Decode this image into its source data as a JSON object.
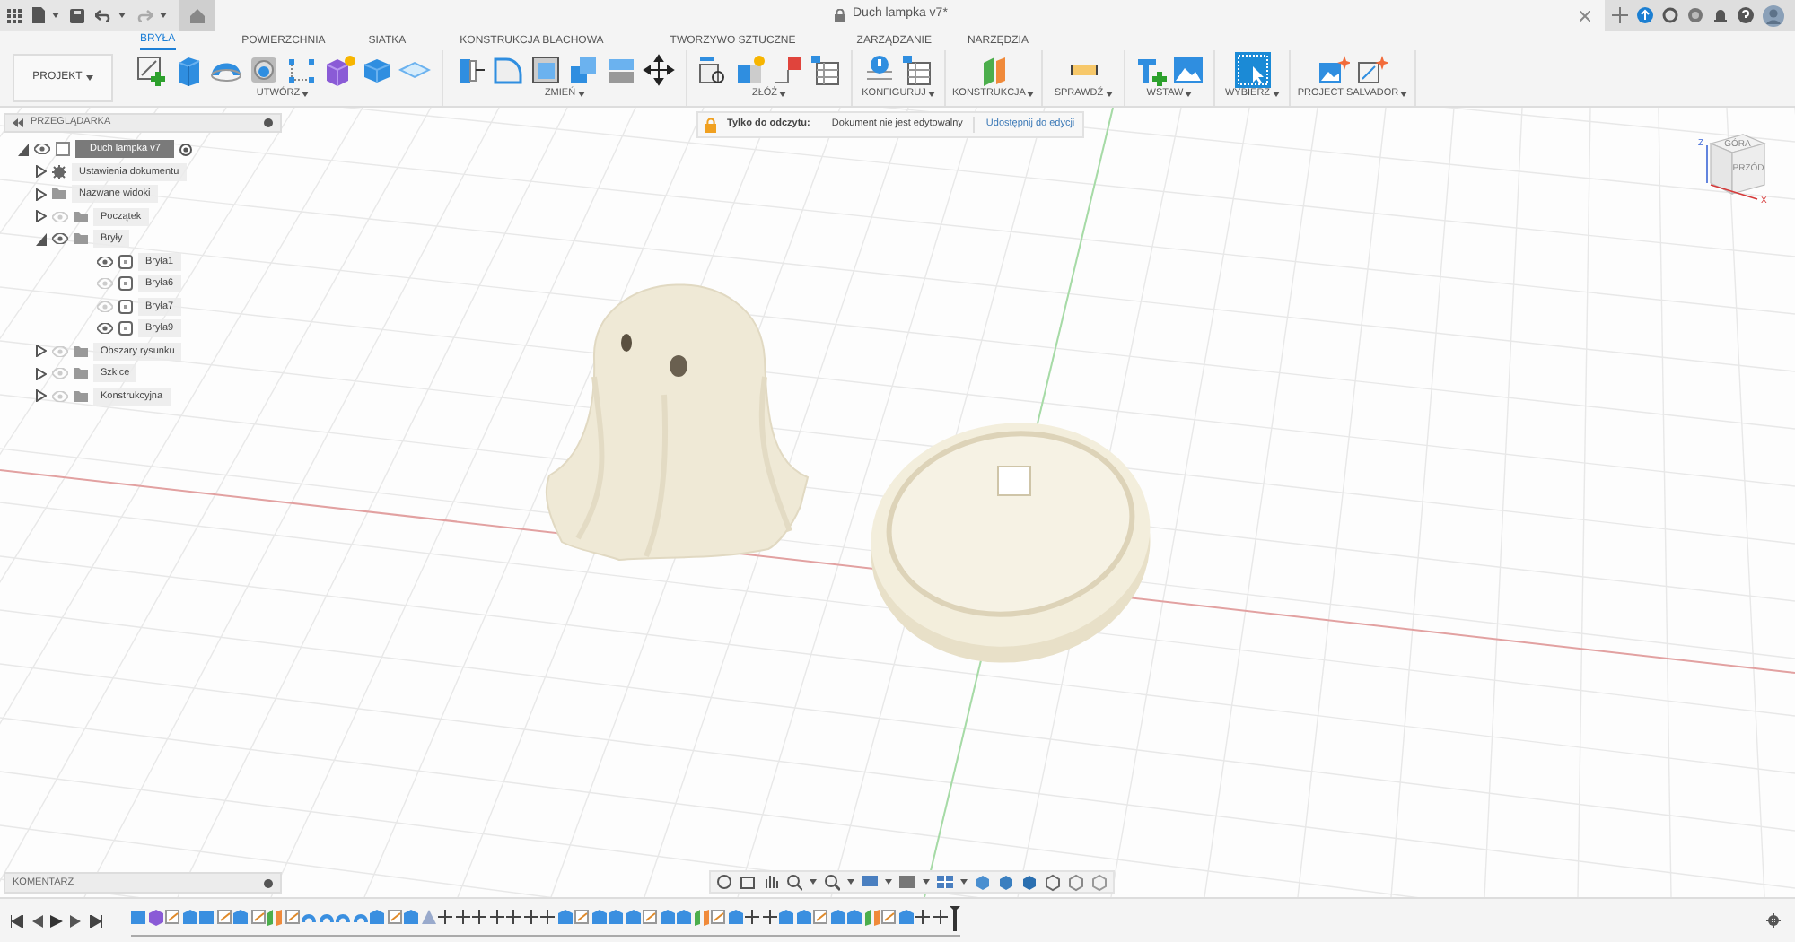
{
  "title_bar": {
    "document_title": "Duch lampka v7*"
  },
  "ribbon": {
    "workspace_button": "PROJEKT",
    "tabs": [
      {
        "label": "BRYŁA",
        "selected": true
      },
      {
        "label": "POWIERZCHNIA",
        "selected": false
      },
      {
        "label": "SIATKA",
        "selected": false
      },
      {
        "label": "KONSTRUKCJA BLACHOWA",
        "selected": false
      },
      {
        "label": "TWORZYWO SZTUCZNE",
        "selected": false
      },
      {
        "label": "ZARZĄDZANIE",
        "selected": false
      },
      {
        "label": "NARZĘDZIA",
        "selected": false
      }
    ],
    "groups": [
      {
        "label": "UTWÓRZ"
      },
      {
        "label": "ZMIEŃ"
      },
      {
        "label": "ZŁÓŻ"
      },
      {
        "label": "KONFIGURUJ"
      },
      {
        "label": "KONSTRUKCJA"
      },
      {
        "label": "SPRAWDŹ"
      },
      {
        "label": "WSTAW"
      },
      {
        "label": "WYBIERZ"
      },
      {
        "label": "PROJECT SALVADOR"
      }
    ]
  },
  "read_only_banner": {
    "label": "Tylko do odczytu:",
    "message": "Dokument nie jest edytowalny",
    "action": "Udostępnij do edycji"
  },
  "browser": {
    "title": "PRZEGLĄDARKA",
    "tree": [
      {
        "label": "Duch lampka v7",
        "kind": "component",
        "expanded": true,
        "visible": true,
        "children": [
          {
            "label": "Ustawienia dokumentu",
            "kind": "settings",
            "expanded": false
          },
          {
            "label": "Nazwane widoki",
            "kind": "folder",
            "expanded": false
          },
          {
            "label": "Początek",
            "kind": "folder",
            "expanded": false,
            "visible": false
          },
          {
            "label": "Bryły",
            "kind": "folder",
            "expanded": true,
            "visible": true,
            "children": [
              {
                "label": "Bryła1",
                "kind": "body",
                "visible": true
              },
              {
                "label": "Bryła6",
                "kind": "body",
                "visible": false
              },
              {
                "label": "Bryła7",
                "kind": "body",
                "visible": false
              },
              {
                "label": "Bryła9",
                "kind": "body",
                "visible": true
              }
            ]
          },
          {
            "label": "Obszary rysunku",
            "kind": "folder",
            "expanded": false,
            "visible": false
          },
          {
            "label": "Szkice",
            "kind": "folder",
            "expanded": false,
            "visible": false
          },
          {
            "label": "Konstrukcyjna",
            "kind": "folder",
            "expanded": false,
            "visible": false
          }
        ]
      }
    ]
  },
  "view_cube": {
    "top": "GÓRA",
    "front": "PRZÓD",
    "z_axis": "Z",
    "x_axis": "X"
  },
  "comments_panel": {
    "title": "KOMENTARZ"
  }
}
